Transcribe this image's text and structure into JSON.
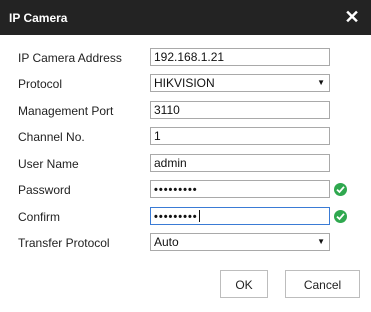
{
  "dialog": {
    "title": "IP Camera",
    "close_icon": "close-icon"
  },
  "fields": {
    "address": {
      "label": "IP Camera Address",
      "value": "192.168.1.21"
    },
    "protocol": {
      "label": "Protocol",
      "value": "HIKVISION"
    },
    "port": {
      "label": "Management Port",
      "value": "3110"
    },
    "channel": {
      "label": "Channel No.",
      "value": "1"
    },
    "username": {
      "label": "User Name",
      "value": "admin"
    },
    "password": {
      "label": "Password",
      "value": "•••••••••",
      "valid": true
    },
    "confirm": {
      "label": "Confirm",
      "value": "•••••••••",
      "valid": true
    },
    "transfer": {
      "label": "Transfer Protocol",
      "value": "Auto"
    }
  },
  "buttons": {
    "ok": "OK",
    "cancel": "Cancel"
  },
  "colors": {
    "titlebar": "#232323",
    "valid": "#2fa84f",
    "focus_border": "#3a7bd5"
  }
}
